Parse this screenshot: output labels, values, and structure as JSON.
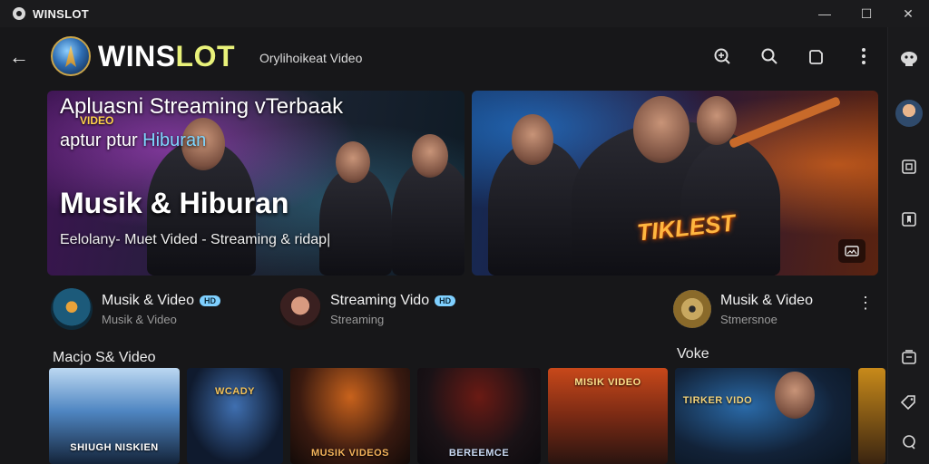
{
  "window": {
    "title": "WINSLOT",
    "controls": {
      "minimize": "—",
      "maximize": "☐",
      "close": "✕"
    }
  },
  "header": {
    "brand_main": "WINS",
    "brand_accent": "LOT",
    "subtitle": "Orylihoikeat Video",
    "icons": [
      "zoom-in-icon",
      "search-icon",
      "share-icon",
      "more-vert-icon"
    ]
  },
  "hero_left": {
    "title": "Apluasni Streaming vTerbaak",
    "tag": "VIDEO",
    "subtitle_prefix": "aptur ptur ",
    "subtitle_highlight": "Hiburan",
    "heading": "Musik & Hiburan",
    "caption": "Eelolany- Muet Vided - Streaming & ridap|"
  },
  "hero_right": {
    "overlay_text": "TIKLEST",
    "expand_icon": "fullscreen-icon"
  },
  "channels": [
    {
      "name": "Musik & Video",
      "badge": "HD",
      "meta": "Musik & Video"
    },
    {
      "name": "Streaming Vido",
      "badge": "HD",
      "meta": "Streaming"
    },
    {
      "name": "Musik & Video",
      "badge": "",
      "meta": "Stmersnoe"
    }
  ],
  "sections": {
    "left_label": "Macjo S& Video",
    "right_label": "Voke"
  },
  "thumbnails": [
    {
      "text": "SHIUGH NISKIEN",
      "accent": "#3a78c8"
    },
    {
      "text": "WCADY",
      "accent": "#2f5f9a"
    },
    {
      "text": "MUSIK VIDEOS",
      "accent": "#c8621c"
    },
    {
      "text": "BEREEMCE",
      "accent": "#8a2a1a"
    },
    {
      "text": "MISIK VIDEO",
      "accent": "#c8481a"
    },
    {
      "text": "TIRKER VIDO",
      "accent": "#2a6aa8"
    },
    {
      "text": "",
      "accent": "#c88a1a"
    }
  ],
  "rail": {
    "icons": [
      "bot-icon",
      "avatar",
      "square-icon",
      "bookmark-icon",
      "library-icon",
      "tag-icon",
      "chat-icon"
    ]
  }
}
